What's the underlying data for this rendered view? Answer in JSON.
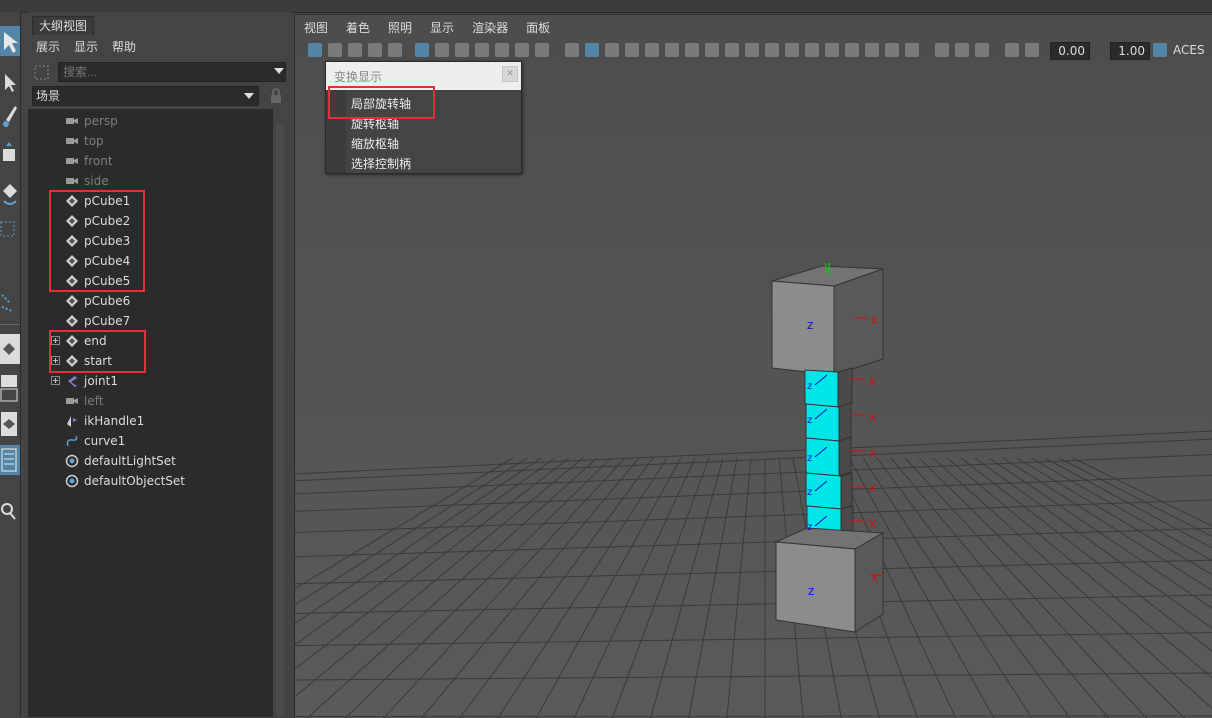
{
  "outliner": {
    "tab": "大纲视图",
    "menu": [
      "展示",
      "显示",
      "帮助"
    ],
    "search_placeholder": "搜索...",
    "scene_filter": "场景",
    "items": [
      {
        "label": "persp",
        "icon": "camera-icon",
        "dim": true
      },
      {
        "label": "top",
        "icon": "camera-icon",
        "dim": true
      },
      {
        "label": "front",
        "icon": "camera-icon",
        "dim": true
      },
      {
        "label": "side",
        "icon": "camera-icon",
        "dim": true
      },
      {
        "label": "pCube1",
        "icon": "mesh-icon",
        "dim": false
      },
      {
        "label": "pCube2",
        "icon": "mesh-icon",
        "dim": false
      },
      {
        "label": "pCube3",
        "icon": "mesh-icon",
        "dim": false
      },
      {
        "label": "pCube4",
        "icon": "mesh-icon",
        "dim": false
      },
      {
        "label": "pCube5",
        "icon": "mesh-icon",
        "dim": false
      },
      {
        "label": "pCube6",
        "icon": "mesh-icon",
        "dim": false
      },
      {
        "label": "pCube7",
        "icon": "mesh-icon",
        "dim": false
      },
      {
        "label": "end",
        "icon": "mesh-icon",
        "dim": false,
        "expandable": true
      },
      {
        "label": "start",
        "icon": "mesh-icon",
        "dim": false,
        "expandable": true
      },
      {
        "label": "joint1",
        "icon": "joint-icon",
        "dim": false,
        "expandable": true
      },
      {
        "label": "left",
        "icon": "camera-icon",
        "dim": true
      },
      {
        "label": "ikHandle1",
        "icon": "ik-handle-icon",
        "dim": false
      },
      {
        "label": "curve1",
        "icon": "curve-icon",
        "dim": false
      },
      {
        "label": "defaultLightSet",
        "icon": "set-icon",
        "dim": false
      },
      {
        "label": "defaultObjectSet",
        "icon": "set-icon",
        "dim": false
      }
    ]
  },
  "viewport": {
    "menu": [
      "视图",
      "着色",
      "照明",
      "显示",
      "渲染器",
      "面板"
    ],
    "toolbar_values": {
      "exposure": "0.00",
      "gamma": "1.00",
      "color_space": "ACES"
    },
    "axis_labels": {
      "x": "x",
      "y": "y",
      "z": "z"
    },
    "colors": {
      "selected_cube": "#00e5e5",
      "x_axis": "#d01010",
      "y_axis": "#10c010",
      "z_axis": "#1010d0",
      "highlight_box": "#e0303a"
    }
  },
  "popup": {
    "title": "变换显示",
    "items": [
      "局部旋转轴",
      "旋转枢轴",
      "缩放枢轴",
      "选择控制柄"
    ]
  }
}
